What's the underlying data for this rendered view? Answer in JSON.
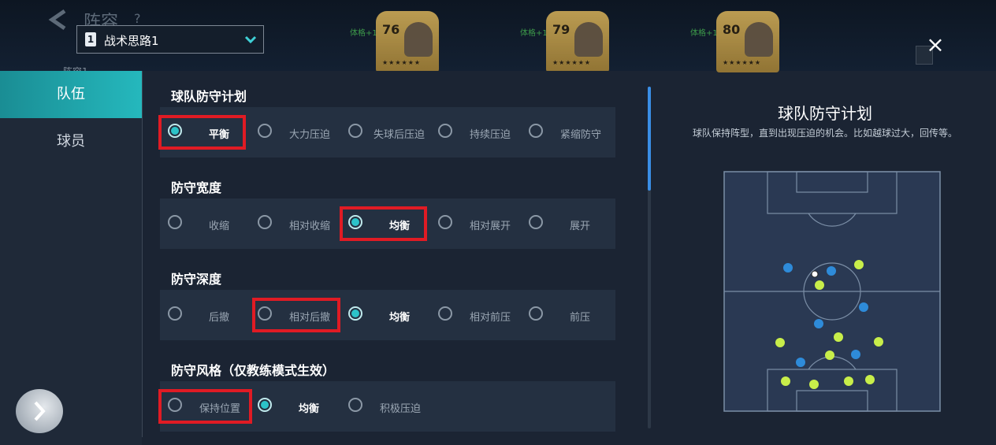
{
  "header": {
    "title": "阵容",
    "help": "?",
    "lineup_name": "阵容1",
    "tactic": {
      "number": "1",
      "label": "战术思路1"
    },
    "player_cards": [
      {
        "rating": "76",
        "fitness": "体格+1",
        "stars": "★★★★★★"
      },
      {
        "rating": "79",
        "fitness": "体格+1",
        "stars": "★★★★★★"
      },
      {
        "rating": "80",
        "fitness": "体格+1",
        "stars": "★★★★★★"
      }
    ],
    "close": "×"
  },
  "nav": {
    "tabs": [
      {
        "label": "队伍",
        "active": true
      },
      {
        "label": "球员",
        "active": false
      }
    ]
  },
  "sections": [
    {
      "title": "球队防守计划",
      "options": [
        "平衡",
        "大力压迫",
        "失球后压迫",
        "持续压迫",
        "紧缩防守"
      ],
      "selected": 0,
      "highlighted": 0
    },
    {
      "title": "防守宽度",
      "options": [
        "收缩",
        "相对收缩",
        "均衡",
        "相对展开",
        "展开"
      ],
      "selected": 2,
      "highlighted": 2
    },
    {
      "title": "防守深度",
      "options": [
        "后撤",
        "相对后撤",
        "均衡",
        "相对前压",
        "前压"
      ],
      "selected": 2,
      "highlighted": 1
    },
    {
      "title": "防守风格（仅教练模式生效）",
      "options": [
        "保持位置",
        "均衡",
        "积极压迫"
      ],
      "selected": 1,
      "highlighted": 0
    }
  ],
  "description": {
    "title": "球队防守计划",
    "text": "球队保持阵型，直到出现压迫的机会。比如越球过大，回传等。"
  },
  "pitch": {
    "colors": {
      "blue_team": "#2e8bd9",
      "yellow_team": "#c8ee4a",
      "line": "#7b8ea6",
      "field": "#2a3953"
    }
  },
  "colors": {
    "accent": "#25b8bd",
    "highlight_box": "#e01b24"
  }
}
